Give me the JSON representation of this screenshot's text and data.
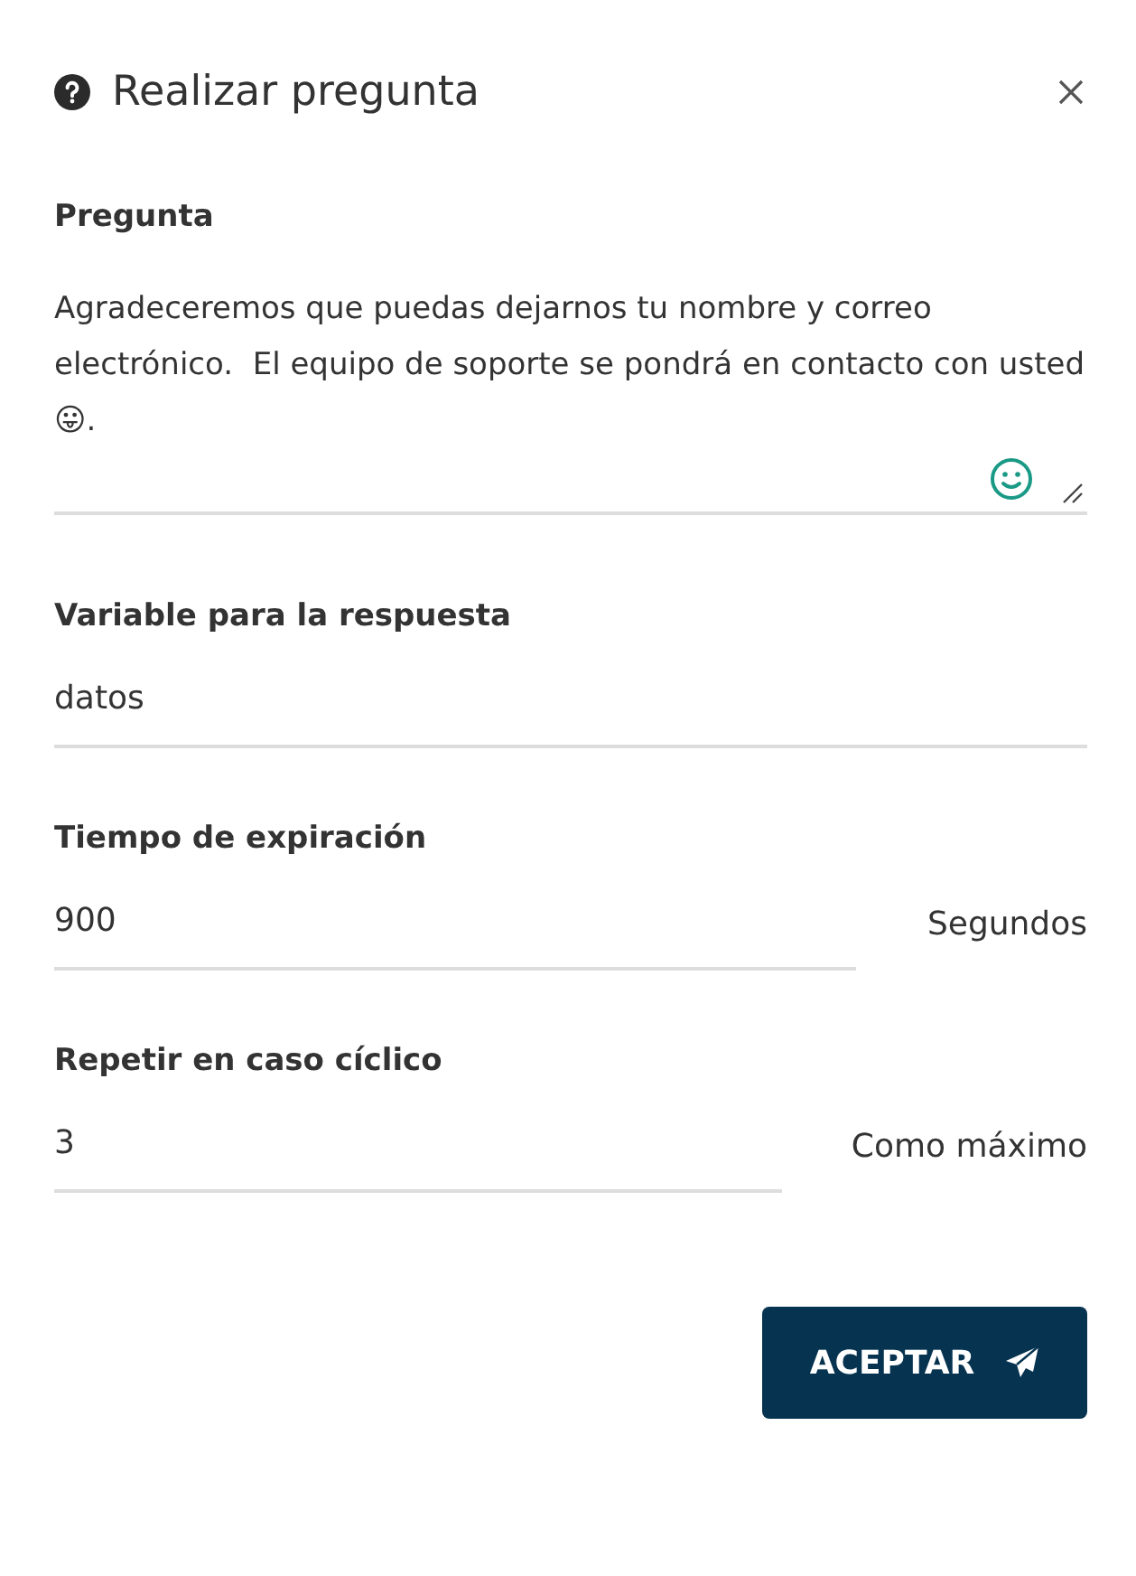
{
  "dialog": {
    "title": "Realizar pregunta"
  },
  "question": {
    "label": "Pregunta",
    "value": "Agradeceremos que puedas dejarnos tu nombre y correo electrónico.  El equipo de soporte se pondrá en contacto con usted 😛."
  },
  "fields": [
    {
      "label": "Variable para la respuesta",
      "value": "datos"
    },
    {
      "label": "Tiempo de expiración",
      "value": "900",
      "suffix": "Segundos"
    },
    {
      "label": "Repetir en caso cíclico",
      "value": "3",
      "suffix": "Como máximo"
    }
  ],
  "buttons": [
    {
      "label": "ACEPTAR"
    }
  ]
}
